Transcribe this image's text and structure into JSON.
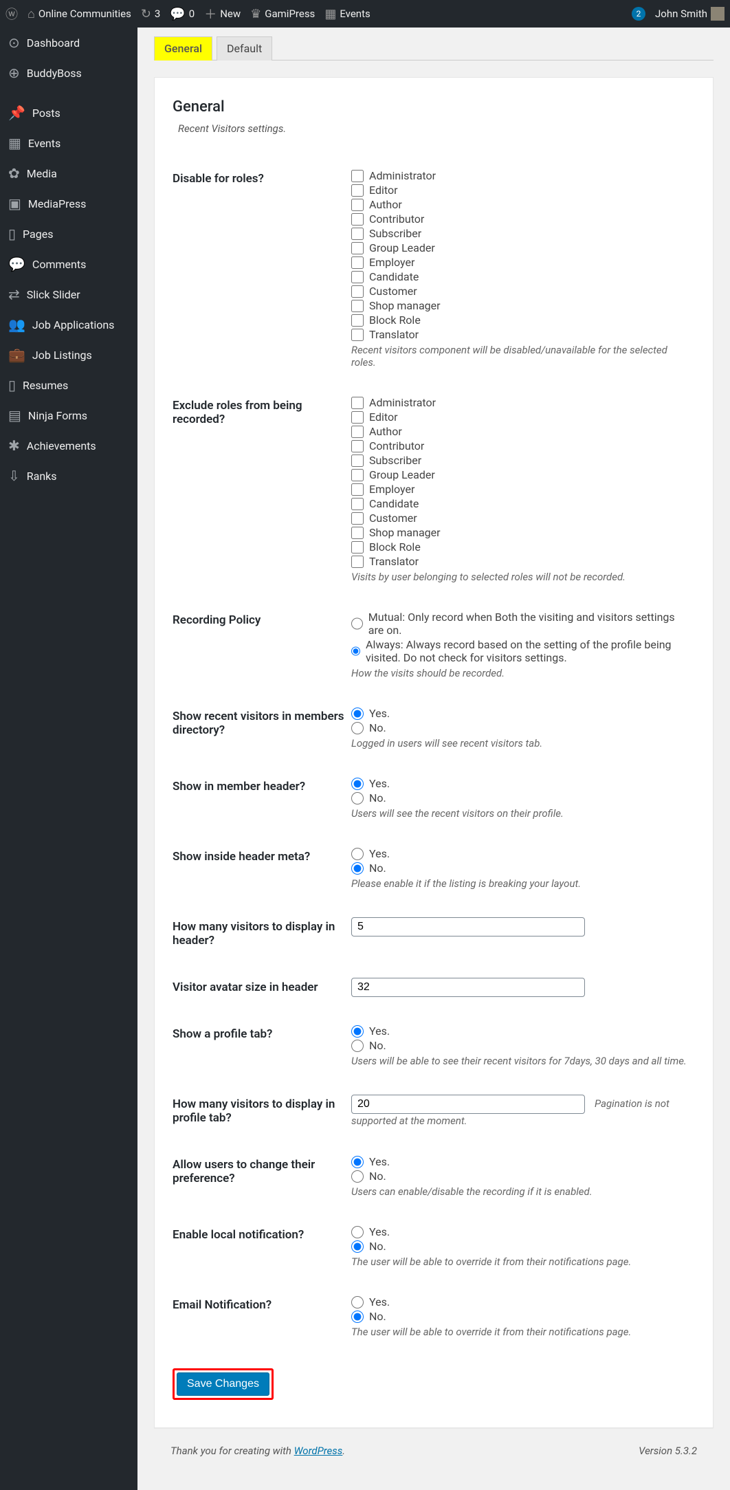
{
  "adminbar": {
    "site_name": "Online Communities",
    "updates_count": "3",
    "comments_count": "0",
    "new_label": "New",
    "gamipress_label": "GamiPress",
    "events_label": "Events",
    "notifications_count": "2",
    "user_name": "John Smith"
  },
  "sidebar": {
    "items": [
      {
        "label": "Dashboard",
        "icon": "◉"
      },
      {
        "label": "BuddyBoss",
        "icon": "⊕"
      },
      {
        "label": "Posts",
        "icon": "✎"
      },
      {
        "label": "Events",
        "icon": "▦"
      },
      {
        "label": "Media",
        "icon": "✿"
      },
      {
        "label": "MediaPress",
        "icon": "▣"
      },
      {
        "label": "Pages",
        "icon": "▯"
      },
      {
        "label": "Comments",
        "icon": "✉"
      },
      {
        "label": "Slick Slider",
        "icon": "⇄"
      },
      {
        "label": "Job Applications",
        "icon": "👥"
      },
      {
        "label": "Job Listings",
        "icon": "⌂"
      },
      {
        "label": "Resumes",
        "icon": "▯"
      },
      {
        "label": "Ninja Forms",
        "icon": "▤"
      },
      {
        "label": "Achievements",
        "icon": "✱"
      },
      {
        "label": "Ranks",
        "icon": "⇩"
      }
    ]
  },
  "tabs": {
    "general": "General",
    "default": "Default"
  },
  "page": {
    "heading": "General",
    "subtitle": "Recent Visitors settings."
  },
  "roles": [
    "Administrator",
    "Editor",
    "Author",
    "Contributor",
    "Subscriber",
    "Group Leader",
    "Employer",
    "Candidate",
    "Customer",
    "Shop manager",
    "Block Role",
    "Translator"
  ],
  "fields": {
    "disable_roles_label": "Disable for roles?",
    "disable_roles_desc": "Recent visitors component will be disabled/unavailable for the selected roles.",
    "exclude_roles_label": "Exclude roles from being recorded?",
    "exclude_roles_desc": "Visits by user belonging to selected roles will not be recorded.",
    "policy_label": "Recording Policy",
    "policy_mutual": "Mutual: Only record when Both the visiting and visitors settings are on.",
    "policy_always": "Always: Always record based on the setting of the profile being visited. Do not check for visitors settings.",
    "policy_desc": "How the visits should be recorded.",
    "show_dir_label": "Show recent visitors in members directory?",
    "show_dir_desc": "Logged in users will see recent visitors tab.",
    "show_header_label": "Show in member header?",
    "show_header_desc": "Users will see the recent visitors on their profile.",
    "show_meta_label": "Show inside header meta?",
    "show_meta_desc": "Please enable it if the listing is breaking your layout.",
    "count_header_label": "How many visitors to display in header?",
    "count_header_value": "5",
    "avatar_size_label": "Visitor avatar size in header",
    "avatar_size_value": "32",
    "profile_tab_label": "Show a profile tab?",
    "profile_tab_desc": "Users will be able to see their recent visitors for 7days, 30 days and all time.",
    "count_tab_label": "How many visitors to display in profile tab?",
    "count_tab_value": "20",
    "count_tab_note": "Pagination is not supported at the moment.",
    "pref_label": "Allow users to change their preference?",
    "pref_desc": "Users can enable/disable the recording if it is enabled.",
    "local_notif_label": "Enable local notification?",
    "local_notif_desc": "The user will be able to override it from their notifications page.",
    "email_notif_label": "Email Notification?",
    "email_notif_desc": "The user will be able to override it from their notifications page.",
    "yes": "Yes.",
    "no": "No.",
    "save_button": "Save Changes"
  },
  "footer": {
    "thanks_prefix": "Thank you for creating with ",
    "wp_link": "WordPress",
    "version": "Version 5.3.2"
  }
}
